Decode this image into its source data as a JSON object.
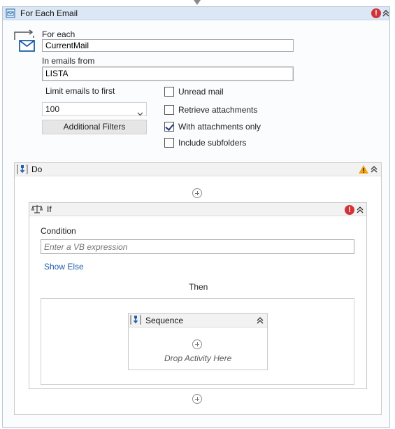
{
  "foreach": {
    "title": "For Each Email",
    "for_each_label": "For each",
    "item_value": "CurrentMail",
    "emails_from_label": "In emails from",
    "emails_from_value": "LISTA",
    "limit_label": "Limit emails to first",
    "limit_value": "100",
    "filters_button": "Additional Filters",
    "checkboxes": [
      {
        "label": "Unread mail",
        "checked": false
      },
      {
        "label": "Retrieve attachments",
        "checked": false
      },
      {
        "label": "With attachments only",
        "checked": true
      },
      {
        "label": "Include subfolders",
        "checked": false
      }
    ],
    "error_badge": "!"
  },
  "do": {
    "title": "Do"
  },
  "if": {
    "title": "If",
    "condition_label": "Condition",
    "condition_placeholder": "Enter a VB expression",
    "show_else": "Show Else",
    "then_label": "Then",
    "error_badge": "!"
  },
  "sequence": {
    "title": "Sequence",
    "drop_text": "Drop Activity Here"
  },
  "colors": {
    "header_blue": "#dbe7f4",
    "error_red": "#d13438",
    "warning_orange": "#f0a30a",
    "link_blue": "#1f5ea8"
  }
}
